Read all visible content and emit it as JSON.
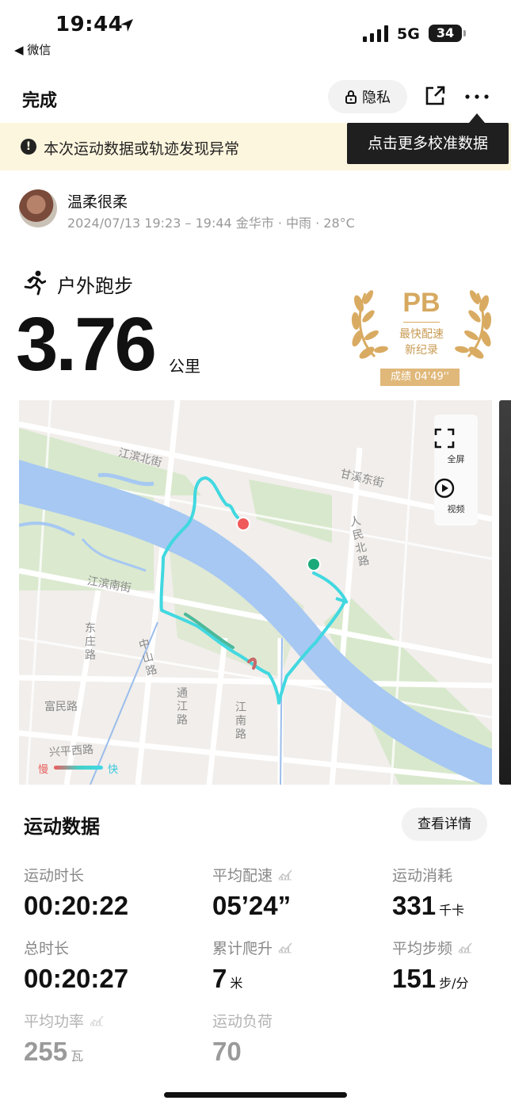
{
  "status_bar": {
    "time": "19:44",
    "back_app": "◀ 微信",
    "network": "5G",
    "battery": "34"
  },
  "nav": {
    "done": "完成",
    "privacy": "隐私",
    "icons": [
      "lock-icon",
      "share-icon",
      "more-icon"
    ]
  },
  "warning": {
    "text": "本次运动数据或轨迹发现异常",
    "tooltip": "点击更多校准数据"
  },
  "user": {
    "name": "温柔很柔",
    "meta": "2024/07/13 19:23 – 19:44 金华市 · 中雨 · 28°C"
  },
  "activity": {
    "type": "户外跑步",
    "distance": "3.76",
    "unit": "公里"
  },
  "pb": {
    "title": "PB",
    "line1": "最快配速",
    "line2": "新纪录",
    "score": "成绩 04'49''",
    "color": "#d6a960"
  },
  "map": {
    "labels": {
      "jiangbin_north": "江滨北街",
      "ganxi_east": "甘溪东街",
      "renmin_north": "人民北路",
      "jiangbin_south": "江滨南街",
      "dongzhuang": "东庄路",
      "zhongshan": "中山路",
      "tongjiang": "通江路",
      "jiangnan": "江南路",
      "fumin": "富民路",
      "xingping_west": "兴平西路"
    },
    "controls": {
      "fullscreen": "全屏",
      "video": "视频"
    },
    "legend": {
      "slow": "慢",
      "fast": "快"
    },
    "colors": {
      "river": "#a6c8f2",
      "park": "#d8e8cc",
      "route": "#41d8e0",
      "start": "#1aaa7a",
      "end": "#ef5a5a"
    }
  },
  "stats": {
    "title": "运动数据",
    "details_button": "查看详情",
    "items": [
      {
        "label": "运动时长",
        "value": "00:20:22",
        "unit": ""
      },
      {
        "label": "平均配速",
        "value": "05’24”",
        "unit": ""
      },
      {
        "label": "运动消耗",
        "value": "331",
        "unit": "千卡"
      },
      {
        "label": "总时长",
        "value": "00:20:27",
        "unit": ""
      },
      {
        "label": "累计爬升",
        "value": "7",
        "unit": "米"
      },
      {
        "label": "平均步频",
        "value": "151",
        "unit": "步/分"
      },
      {
        "label": "平均功率",
        "value": "255",
        "unit": "瓦"
      },
      {
        "label": "运动负荷",
        "value": "70",
        "unit": ""
      }
    ]
  }
}
